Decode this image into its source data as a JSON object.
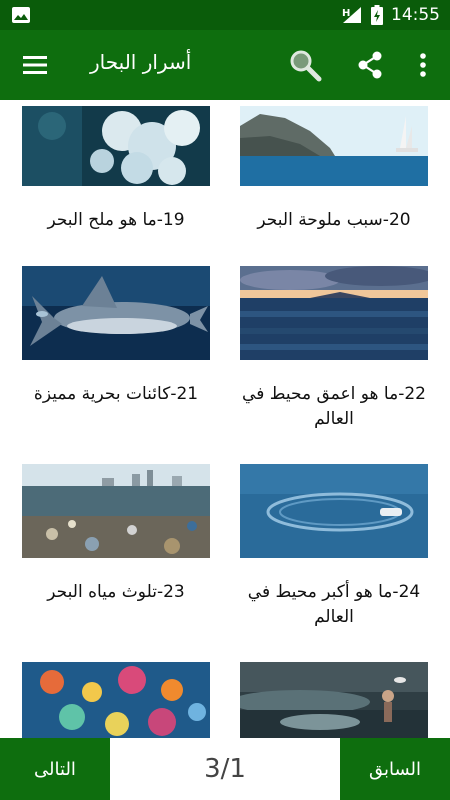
{
  "status_bar": {
    "time": "14:55",
    "icons": [
      "image-icon",
      "signal-h-icon",
      "battery-charging-icon"
    ]
  },
  "app_bar": {
    "title": "أسرار البحار",
    "icons": [
      "menu-icon",
      "search-icon",
      "share-icon",
      "more-vert-icon"
    ]
  },
  "articles": [
    {
      "title": "19-ما هو ملح البحر",
      "image": "coral"
    },
    {
      "title": "20-سبب ملوحة البحر",
      "image": "sailboat-cliff"
    },
    {
      "title": "21-كائنات بحرية مميزة",
      "image": "shark"
    },
    {
      "title": "22-ما هو اعمق محيط في العالم",
      "image": "ocean-sunset"
    },
    {
      "title": "23-تلوث مياه البحر",
      "image": "polluted-shore"
    },
    {
      "title": "24-ما هو أكبر محيط في العالم",
      "image": "speedboat"
    },
    {
      "title": "",
      "image": "coral-reef"
    },
    {
      "title": "",
      "image": "mermaid-storm"
    }
  ],
  "pagination": {
    "next_label": "التالى",
    "prev_label": "السابق",
    "indicator": "3/1"
  },
  "colors": {
    "status_bar": "#0a5c0a",
    "app_bar": "#0e6e0e",
    "buttons": "#0e6e0e",
    "text": "#111111"
  }
}
